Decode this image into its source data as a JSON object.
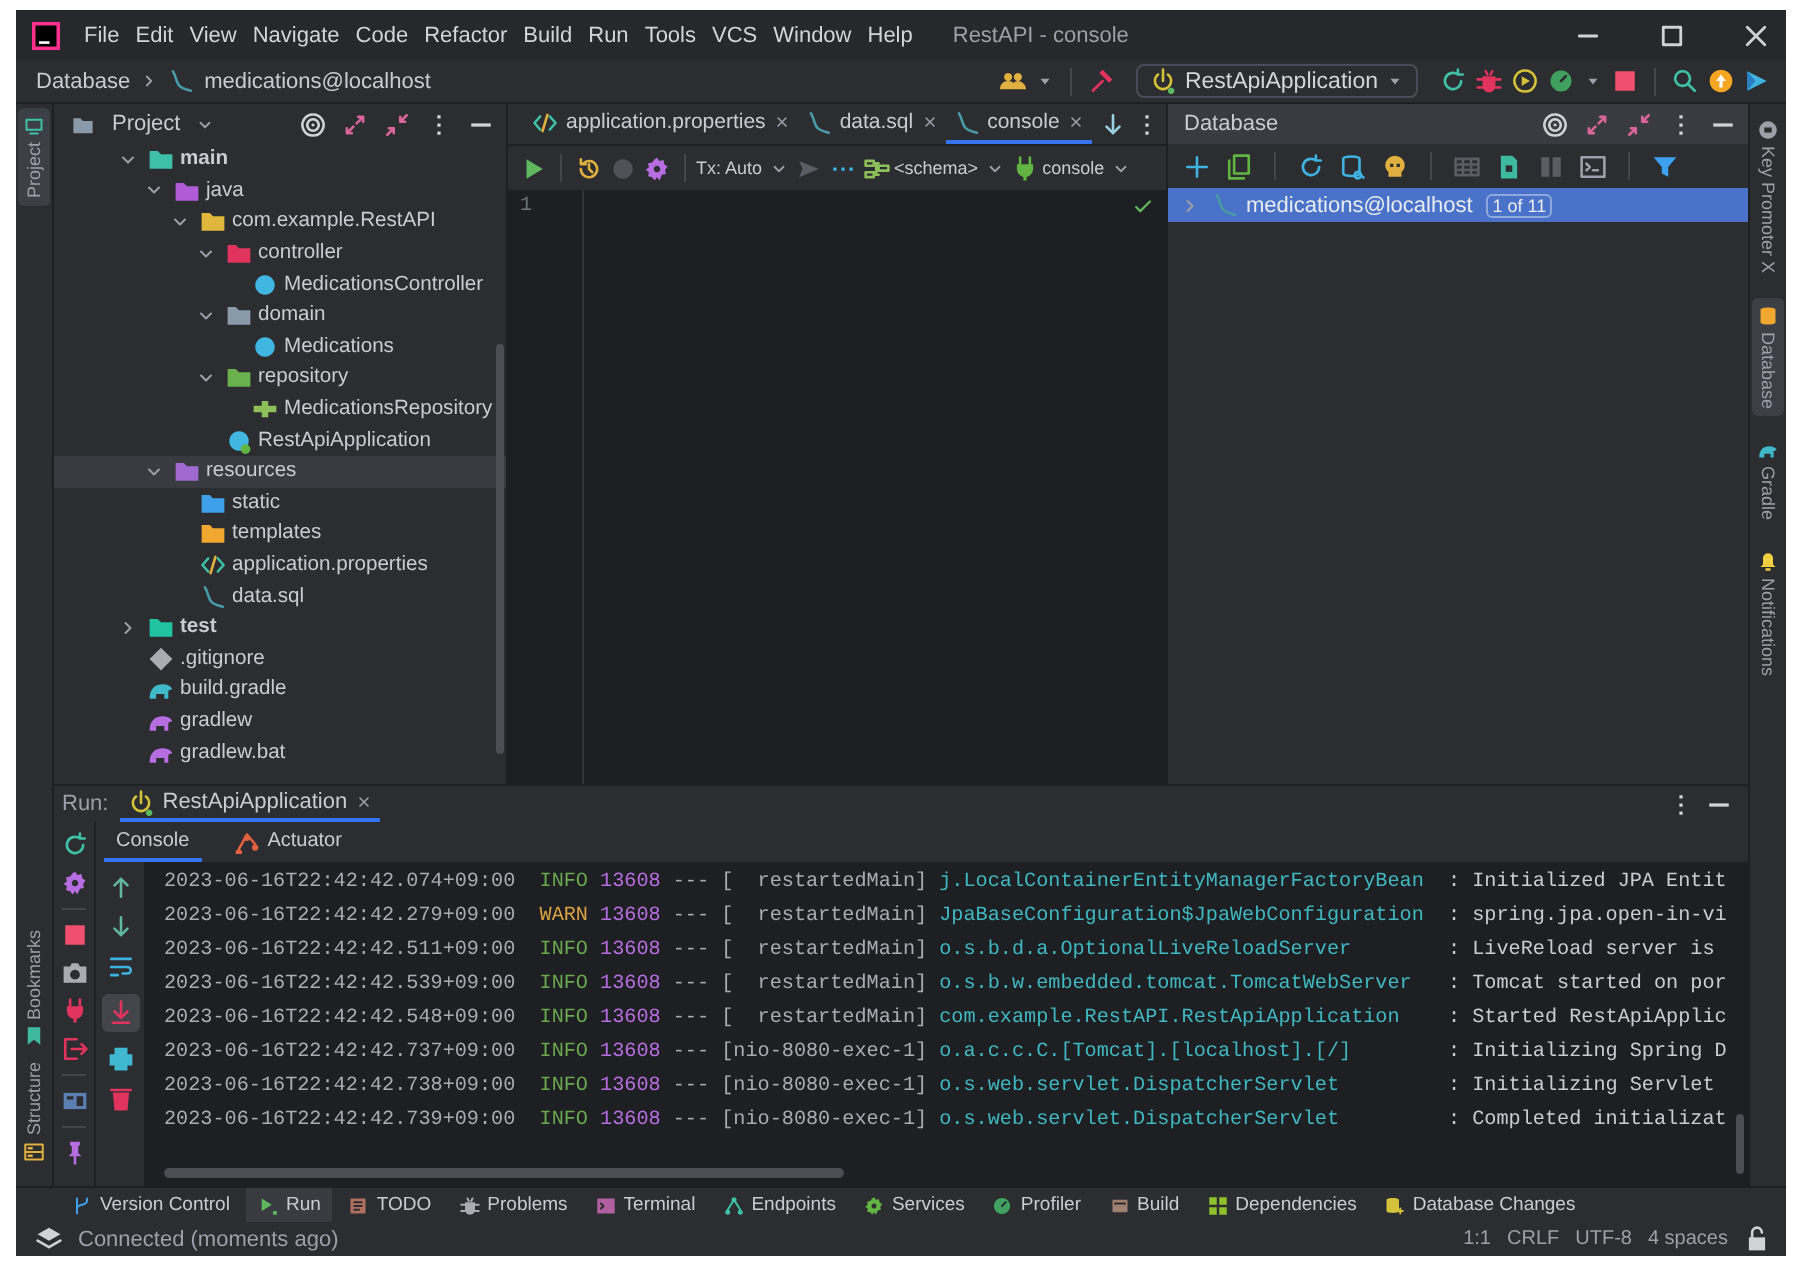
{
  "window": {
    "title": "RestAPI - console"
  },
  "menu": [
    "File",
    "Edit",
    "View",
    "Navigate",
    "Code",
    "Refactor",
    "Build",
    "Run",
    "Tools",
    "VCS",
    "Window",
    "Help"
  ],
  "breadcrumb": [
    "Database",
    "medications@localhost"
  ],
  "run_config": "RestApiApplication",
  "left_tabs": [
    {
      "label": "Project",
      "selected": true
    },
    {
      "label": "Bookmarks",
      "selected": false
    },
    {
      "label": "Structure",
      "selected": false
    }
  ],
  "project": {
    "title": "Project",
    "tree": [
      {
        "label": "main",
        "kind": "source-root",
        "expanded": true,
        "selected": false,
        "children": [
          {
            "label": "java",
            "kind": "java-root",
            "expanded": true,
            "selected": false,
            "children": [
              {
                "label": "com.example.RestAPI",
                "kind": "package",
                "expanded": true,
                "selected": false,
                "children": [
                  {
                    "label": "controller",
                    "kind": "controller-package",
                    "expanded": true,
                    "selected": false,
                    "children": [
                      {
                        "label": "MedicationsController",
                        "kind": "class",
                        "selected": false
                      }
                    ]
                  },
                  {
                    "label": "domain",
                    "kind": "domain-package",
                    "expanded": true,
                    "selected": false,
                    "children": [
                      {
                        "label": "Medications",
                        "kind": "class",
                        "selected": false
                      }
                    ]
                  },
                  {
                    "label": "repository",
                    "kind": "repository-package",
                    "expanded": true,
                    "selected": false,
                    "children": [
                      {
                        "label": "MedicationsRepository",
                        "kind": "repository-interface",
                        "selected": false
                      }
                    ]
                  },
                  {
                    "label": "RestApiApplication",
                    "kind": "spring-class",
                    "selected": false
                  }
                ]
              }
            ]
          },
          {
            "label": "resources",
            "kind": "resources-root",
            "expanded": true,
            "selected": true,
            "children": [
              {
                "label": "static",
                "kind": "web-folder",
                "selected": false
              },
              {
                "label": "templates",
                "kind": "templates-folder",
                "selected": false
              },
              {
                "label": "application.properties",
                "kind": "properties",
                "selected": false
              },
              {
                "label": "data.sql",
                "kind": "sql",
                "selected": false
              }
            ]
          }
        ]
      },
      {
        "label": "test",
        "kind": "test-root",
        "expanded": false,
        "selected": false
      },
      {
        "label": ".gitignore",
        "kind": "git",
        "selected": false
      },
      {
        "label": "build.gradle",
        "kind": "gradle-file",
        "selected": false
      },
      {
        "label": "gradlew",
        "kind": "gradle-wrapper",
        "selected": false
      },
      {
        "label": "gradlew.bat",
        "kind": "gradle-wrapper",
        "selected": false
      }
    ]
  },
  "editor": {
    "tabs": [
      {
        "label": "application.properties",
        "selected": false
      },
      {
        "label": "data.sql",
        "selected": false
      },
      {
        "label": "console",
        "selected": true
      }
    ],
    "tx_mode": "Tx: Auto",
    "schema": "<schema>",
    "session": "console",
    "line_numbers": [
      "1"
    ]
  },
  "database": {
    "title": "Database",
    "tree": [
      {
        "label": "medications@localhost",
        "badge": "1 of 11",
        "expanded": false,
        "selected": true
      }
    ]
  },
  "right_tabs": [
    {
      "label": "Key Promoter X",
      "selected": false
    },
    {
      "label": "Database",
      "selected": true
    },
    {
      "label": "Gradle",
      "selected": false
    },
    {
      "label": "Notifications",
      "selected": false
    }
  ],
  "run": {
    "label": "Run:",
    "tabs": [
      {
        "label": "RestApiApplication",
        "selected": true
      }
    ],
    "subtabs": [
      {
        "label": "Console",
        "selected": true
      },
      {
        "label": "Actuator",
        "selected": false
      }
    ],
    "log": [
      {
        "time": "2023-06-16T22:42:42.074+09:00",
        "kind": "info",
        "severity": "INFO",
        "pid": "13608",
        "thread": "--- [  restartedMain]",
        "logger": "j.LocalContainerEntityManagerFactoryBean",
        "message": ": Initialized JPA Entit"
      },
      {
        "time": "2023-06-16T22:42:42.279+09:00",
        "kind": "warn",
        "severity": "WARN",
        "pid": "13608",
        "thread": "--- [  restartedMain]",
        "logger": "JpaBaseConfiguration$JpaWebConfiguration",
        "message": ": spring.jpa.open-in-vi"
      },
      {
        "time": "2023-06-16T22:42:42.511+09:00",
        "kind": "info",
        "severity": "INFO",
        "pid": "13608",
        "thread": "--- [  restartedMain]",
        "logger": "o.s.b.d.a.OptionalLiveReloadServer",
        "message": ": LiveReload server is"
      },
      {
        "time": "2023-06-16T22:42:42.539+09:00",
        "kind": "info",
        "severity": "INFO",
        "pid": "13608",
        "thread": "--- [  restartedMain]",
        "logger": "o.s.b.w.embedded.tomcat.TomcatWebServer",
        "message": ": Tomcat started on por"
      },
      {
        "time": "2023-06-16T22:42:42.548+09:00",
        "kind": "info",
        "severity": "INFO",
        "pid": "13608",
        "thread": "--- [  restartedMain]",
        "logger": "com.example.RestAPI.RestApiApplication",
        "message": ": Started RestApiApplic"
      },
      {
        "time": "2023-06-16T22:42:42.737+09:00",
        "kind": "info",
        "severity": "INFO",
        "pid": "13608",
        "thread": "--- [nio-8080-exec-1]",
        "logger": "o.a.c.c.C.[Tomcat].[localhost].[/]",
        "message": ": Initializing Spring D"
      },
      {
        "time": "2023-06-16T22:42:42.738+09:00",
        "kind": "info",
        "severity": "INFO",
        "pid": "13608",
        "thread": "--- [nio-8080-exec-1]",
        "logger": "o.s.web.servlet.DispatcherServlet",
        "message": ": Initializing Servlet"
      },
      {
        "time": "2023-06-16T22:42:42.739+09:00",
        "kind": "info",
        "severity": "INFO",
        "pid": "13608",
        "thread": "--- [nio-8080-exec-1]",
        "logger": "o.s.web.servlet.DispatcherServlet",
        "message": ": Completed initializat"
      }
    ]
  },
  "tool_tabs": [
    {
      "label": "Version Control",
      "selected": false
    },
    {
      "label": "Run",
      "selected": true
    },
    {
      "label": "TODO",
      "selected": false
    },
    {
      "label": "Problems",
      "selected": false
    },
    {
      "label": "Terminal",
      "selected": false
    },
    {
      "label": "Endpoints",
      "selected": false
    },
    {
      "label": "Services",
      "selected": false
    },
    {
      "label": "Profiler",
      "selected": false
    },
    {
      "label": "Build",
      "selected": false
    },
    {
      "label": "Dependencies",
      "selected": false
    },
    {
      "label": "Database Changes",
      "selected": false
    }
  ],
  "status": {
    "message": "Connected (moments ago)",
    "items": [
      "1:1",
      "CRLF",
      "UTF-8",
      "4 spaces"
    ]
  }
}
